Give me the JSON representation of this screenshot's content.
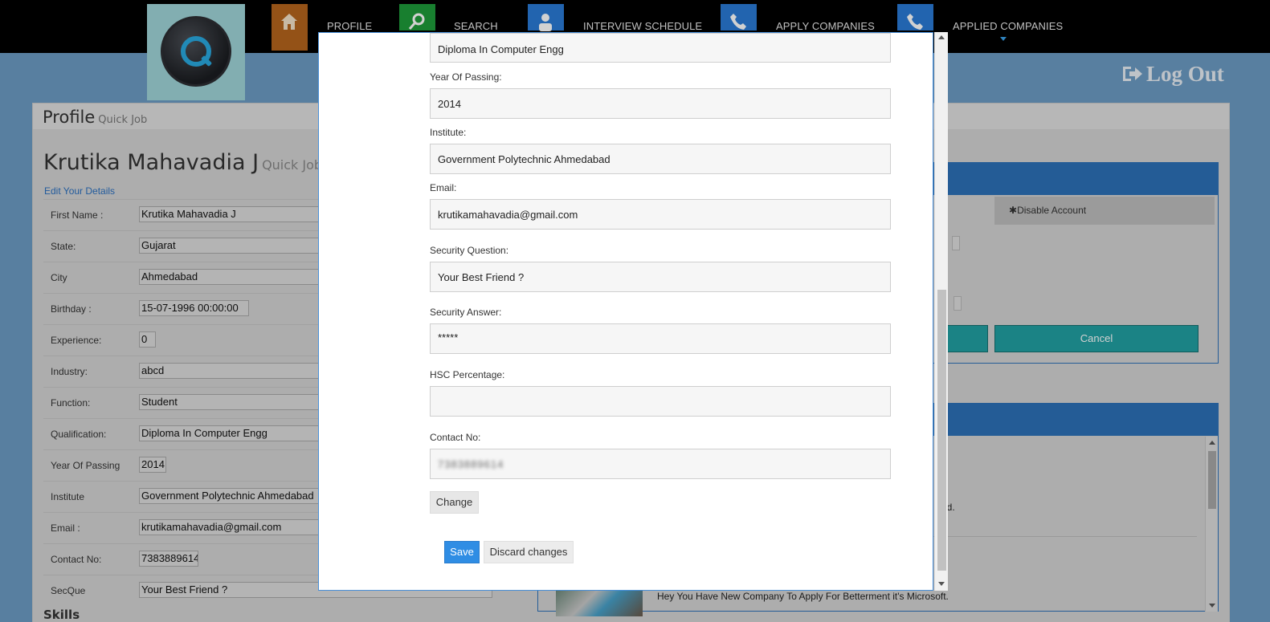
{
  "nav": {
    "items": [
      {
        "label": "PROFILE",
        "icon": "home-icon",
        "color": "#b5651d"
      },
      {
        "label": "SEARCH",
        "icon": "search-icon",
        "color": "#1e9c3a"
      },
      {
        "label": "INTERVIEW SCHEDULE",
        "icon": "user-icon",
        "color": "#2a7ad6"
      },
      {
        "label": "APPLY COMPANIES",
        "icon": "phone-icon",
        "color": "#2a7ad6"
      },
      {
        "label": "APPLIED COMPANIES",
        "icon": "phone-icon",
        "color": "#2a7ad6"
      }
    ]
  },
  "header": {
    "logout_label": "Log Out"
  },
  "profile": {
    "title": "Profile",
    "title_sub": "Quick Job",
    "name": "Krutika Mahavadia J",
    "name_sub": "Quick Job",
    "edit_link": "Edit Your Details",
    "fields": [
      {
        "label": "First Name :",
        "value": "Krutika Mahavadia J"
      },
      {
        "label": "State:",
        "value": "Gujarat"
      },
      {
        "label": "City",
        "value": "Ahmedabad"
      },
      {
        "label": "Birthday :",
        "value": "15-07-1996 00:00:00"
      },
      {
        "label": "Experience:",
        "value": "0"
      },
      {
        "label": "Industry:",
        "value": "abcd"
      },
      {
        "label": "Function:",
        "value": "Student"
      },
      {
        "label": "Qualification:",
        "value": "Diploma In Computer Engg"
      },
      {
        "label": "Year Of Passing",
        "value": "2014"
      },
      {
        "label": "Institute",
        "value": "Government Polytechnic Ahmedabad"
      },
      {
        "label": "Email :",
        "value": "krutikamahavadia@gmail.com"
      },
      {
        "label": "Contact No:",
        "value": "7383889614"
      },
      {
        "label": "SecQue",
        "value": "Your Best Friend ?"
      }
    ],
    "skills_heading": "Skills"
  },
  "account_box": {
    "disable_label": "Disable Account",
    "cancel_label": "Cancel"
  },
  "notices": {
    "line1_fragment": "ed.",
    "line2": "Hey You Have New Company To Apply For Betterment it's Microsoft."
  },
  "modal": {
    "top_value": "Diploma In Computer Engg",
    "fields": [
      {
        "label": "Year Of Passing:",
        "value": "2014"
      },
      {
        "label": "Institute:",
        "value": "Government Polytechnic Ahmedabad"
      },
      {
        "label": "Email:",
        "value": "krutikamahavadia@gmail.com"
      },
      {
        "label": "Security Question:",
        "value": "Your Best Friend ?"
      },
      {
        "label": "Security Answer:",
        "value": "*****"
      },
      {
        "label": "HSC Percentage:",
        "value": ""
      },
      {
        "label": "Contact No:",
        "value": "7383889614"
      }
    ],
    "change_label": "Change",
    "save_label": "Save",
    "discard_label": "Discard changes"
  }
}
